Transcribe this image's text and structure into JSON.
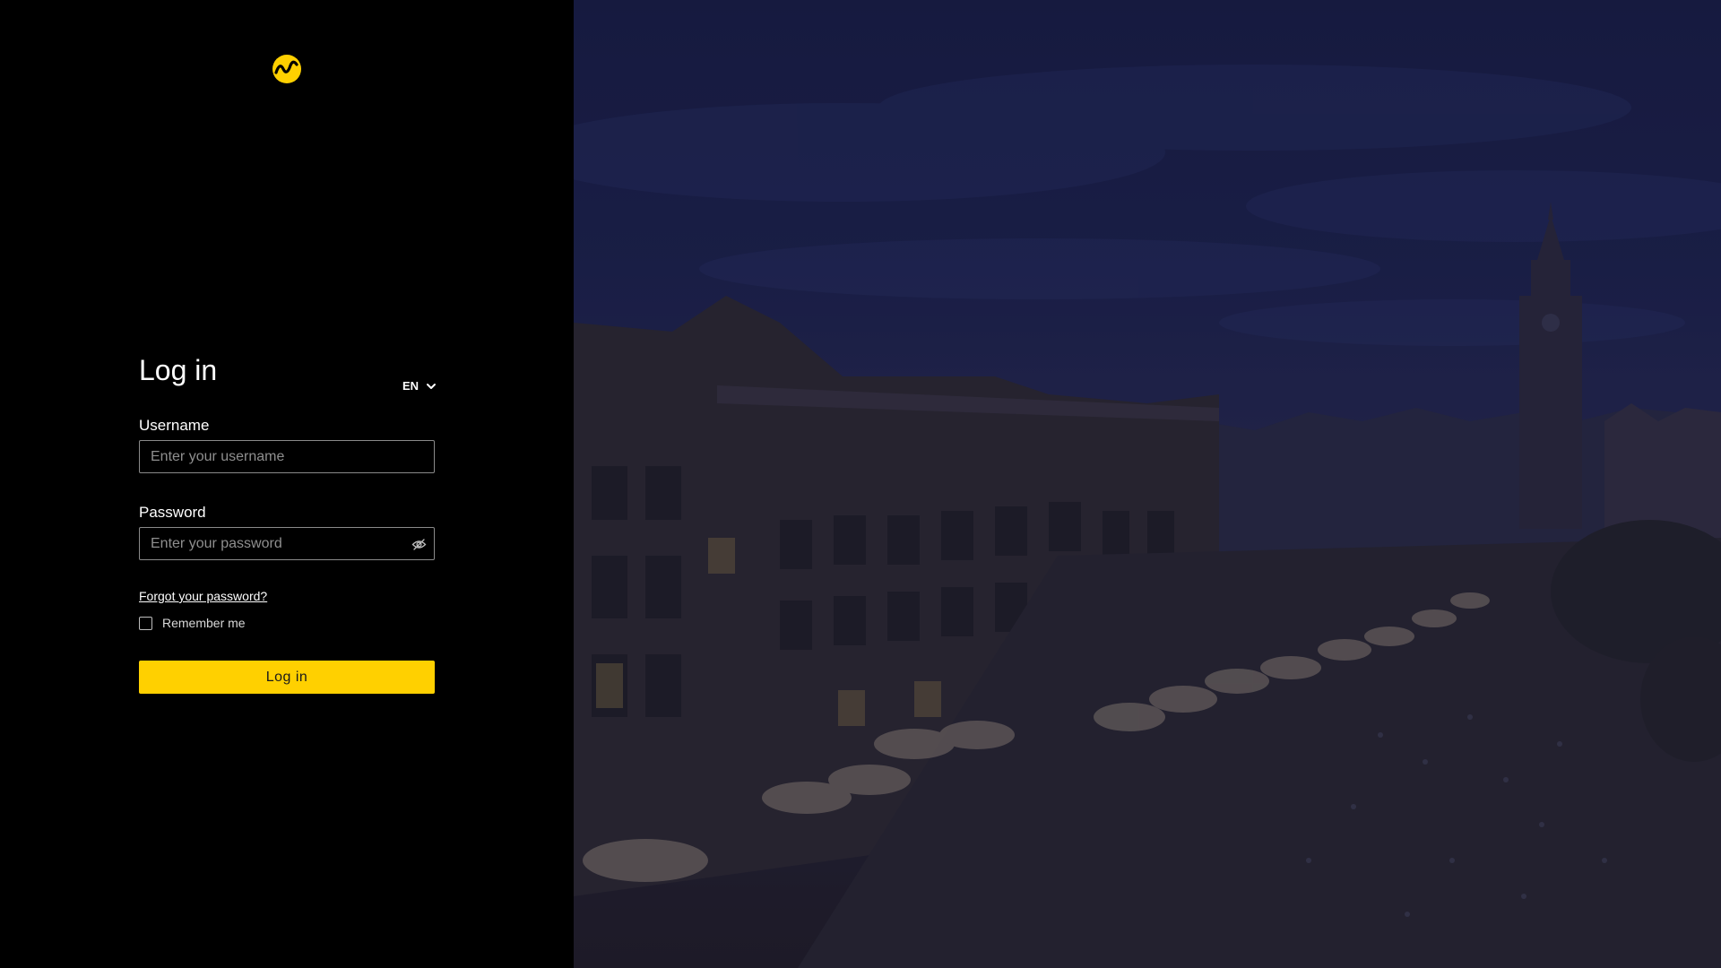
{
  "logo": {
    "icon": "wave-logo-icon",
    "color": "#ffd000"
  },
  "login": {
    "title": "Log in",
    "language": {
      "selected": "EN"
    },
    "username": {
      "label": "Username",
      "placeholder": "Enter your username",
      "value": ""
    },
    "password": {
      "label": "Password",
      "placeholder": "Enter your password",
      "value": ""
    },
    "forgot_link": "Forgot your password?",
    "remember_label": "Remember me",
    "remember_checked": false,
    "submit_label": "Log in"
  },
  "colors": {
    "accent": "#ffd000",
    "panel_bg": "#000000",
    "scene_sky": "#1e2452"
  },
  "background": {
    "icon": "night-city-square-illustration"
  }
}
